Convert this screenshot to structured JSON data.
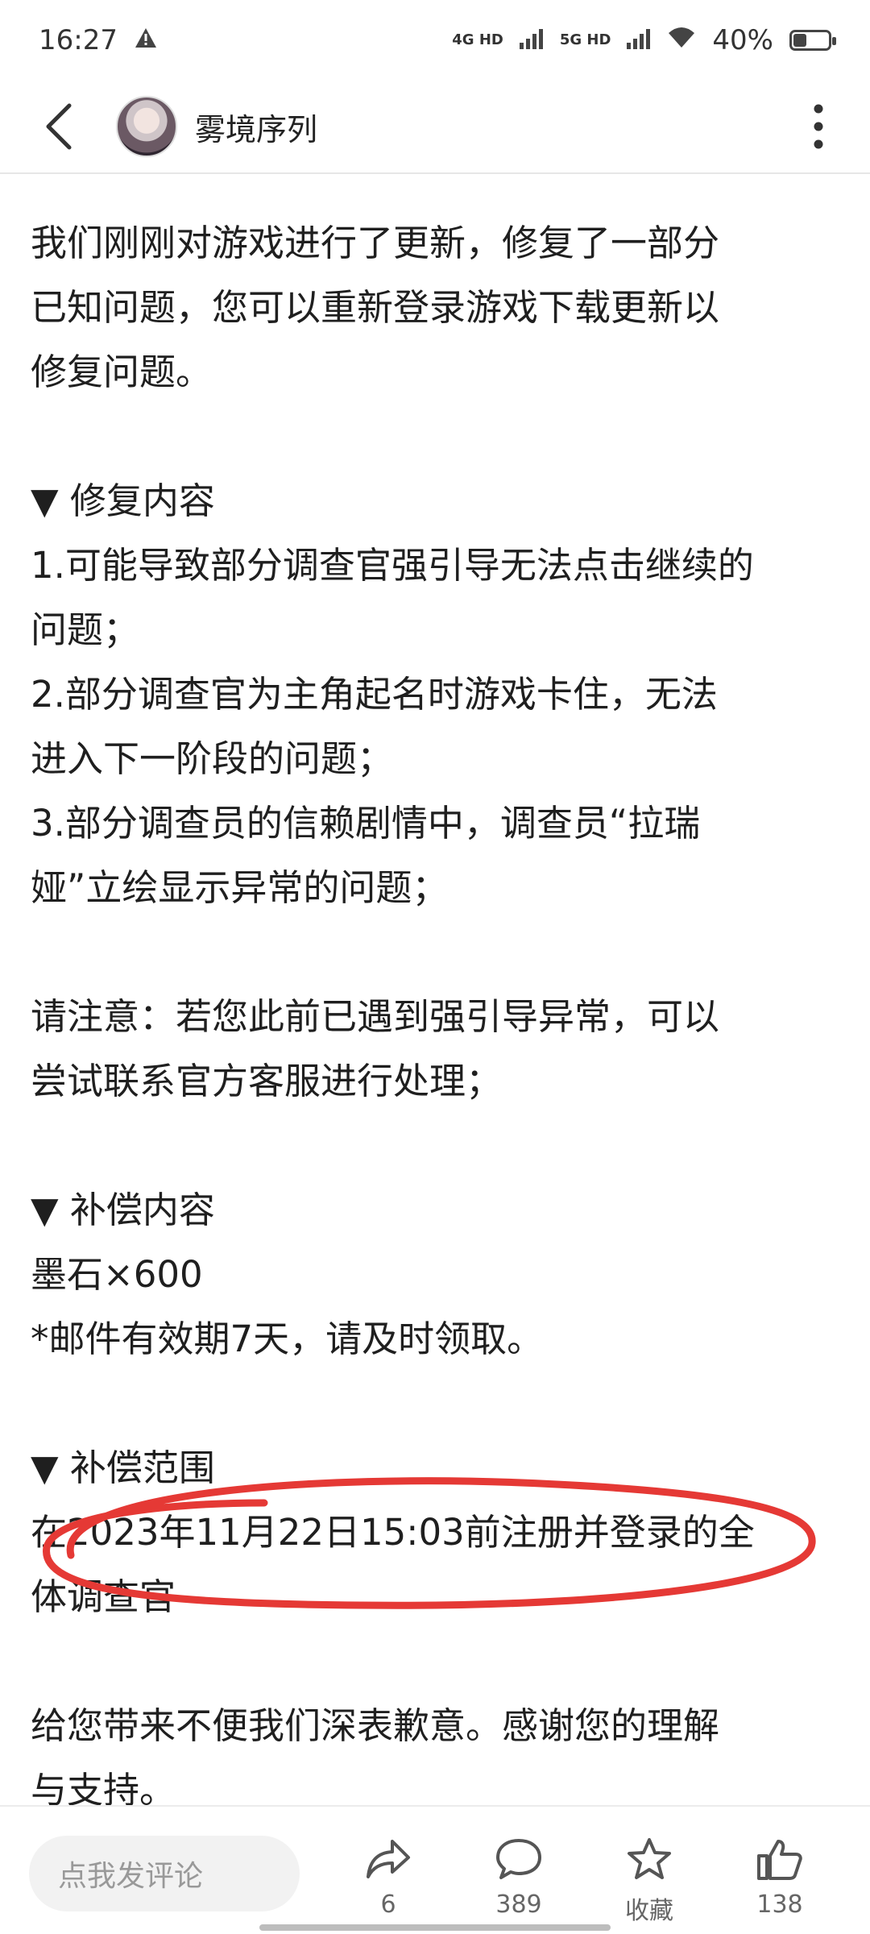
{
  "status_bar": {
    "time": "16:27",
    "net1": "4G HD",
    "net2": "5G HD",
    "battery": "40%",
    "battery_level": 0.4
  },
  "header": {
    "title": "雾境序列"
  },
  "article": {
    "intro": [
      "我们刚刚对游戏进行了更新，修复了一部分",
      "已知问题，您可以重新登录游戏下载更新以",
      "修复问题。"
    ],
    "fix_heading": "▼ 修复内容",
    "fix_items": [
      "1.可能导致部分调查官强引导无法点击继续的",
      "问题；",
      "2.部分调查官为主角起名时游戏卡住，无法",
      "进入下一阶段的问题；",
      "3.部分调查员的信赖剧情中，调查员“拉瑞",
      "娅”立绘显示异常的问题；"
    ],
    "notice": [
      "请注意：若您此前已遇到强引导异常，可以",
      "尝试联系官方客服进行处理；"
    ],
    "comp_heading": "▼ 补偿内容",
    "comp_items": [
      "墨石×600",
      "*邮件有效期7天，请及时领取。"
    ],
    "scope_heading": "▼ 补偿范围",
    "scope_lines": [
      "在2023年11月22日15:03前注册并登录的全",
      "体调查官"
    ],
    "closing": [
      "给您带来不便我们深表歉意。感谢您的理解",
      "与支持。"
    ]
  },
  "bottom_bar": {
    "comment_placeholder": "点我发评论",
    "share_count": "6",
    "comment_count": "389",
    "favorite_label": "收藏",
    "like_count": "138"
  },
  "colors": {
    "annotation_red": "#e53935"
  }
}
